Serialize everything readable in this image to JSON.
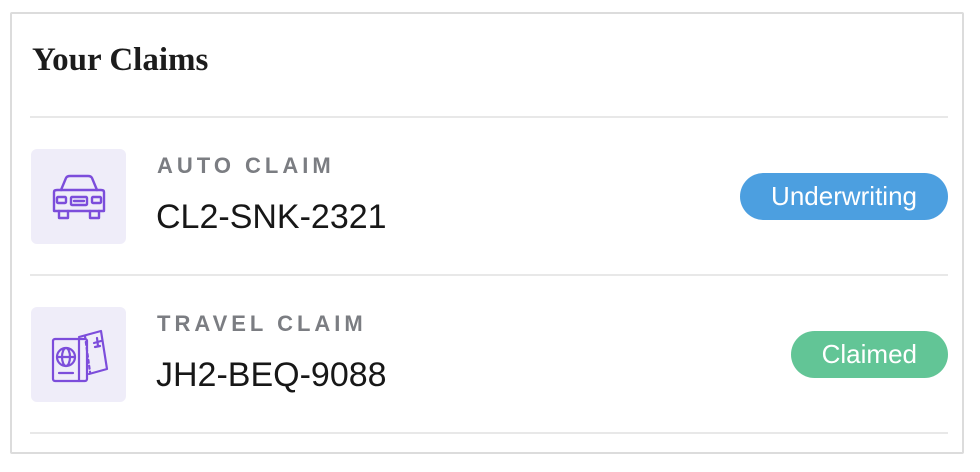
{
  "title": "Your Claims",
  "claims": [
    {
      "type": "AUTO CLAIM",
      "id": "CL2-SNK-2321",
      "status": "Underwriting",
      "status_color": "#4c9fe0",
      "icon": "car-icon"
    },
    {
      "type": "TRAVEL CLAIM",
      "id": "JH2-BEQ-9088",
      "status": "Claimed",
      "status_color": "#62c596",
      "icon": "passport-ticket-icon"
    }
  ],
  "colors": {
    "icon_stroke": "#7c4ddb",
    "icon_tile_bg": "#efedf9"
  }
}
